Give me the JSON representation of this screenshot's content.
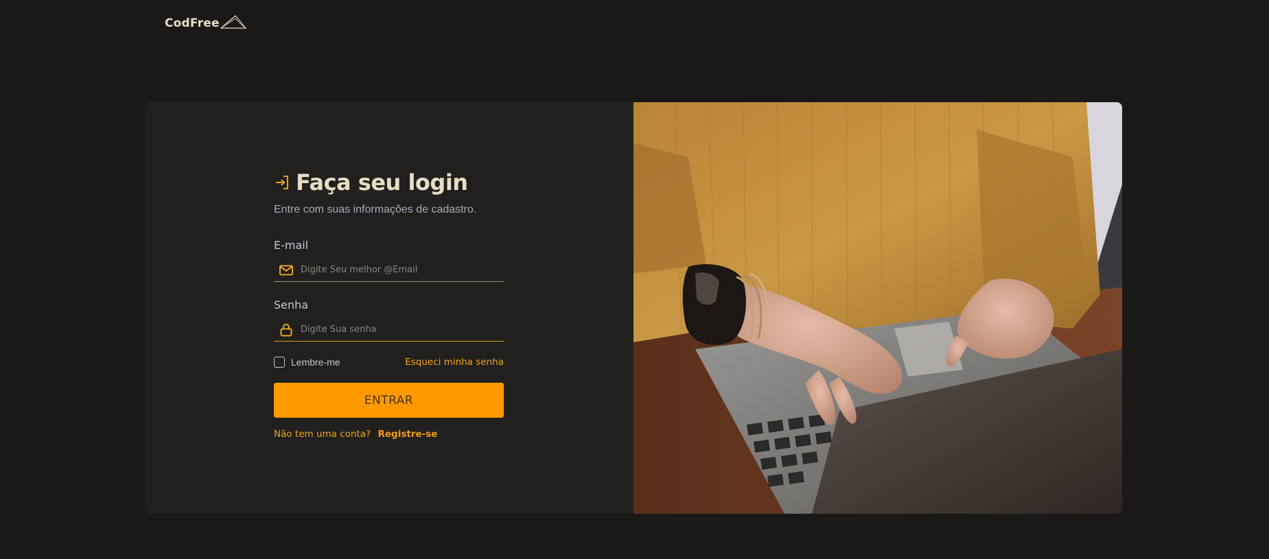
{
  "header": {
    "logo_text": "CodFree"
  },
  "login": {
    "title": "Faça seu login",
    "subtitle": "Entre com suas informações de cadastro.",
    "email": {
      "label": "E-mail",
      "placeholder": "Digite Seu melhor @Email",
      "value": ""
    },
    "password": {
      "label": "Senha",
      "placeholder": "Digite Sua senha",
      "value": ""
    },
    "remember_label": "Lembre-me",
    "remember_checked": false,
    "forgot_label": "Esqueci minha senha",
    "submit_label": "ENTRAR",
    "no_account_text": "Não tem uma conta?",
    "register_label": "Registre-se"
  },
  "colors": {
    "background": "#1b1918",
    "card": "#22201e",
    "accent": "#ff9900",
    "link": "#f1a31c",
    "heading": "#e8dcc4"
  },
  "icons": {
    "title": "sign-in-arrow-icon",
    "email": "envelope-icon",
    "password": "lock-icon",
    "logo": "mountain-peak-icon"
  }
}
